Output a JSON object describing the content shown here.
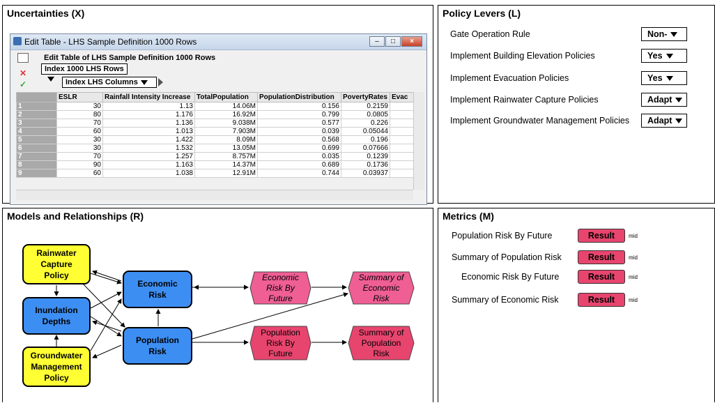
{
  "panels": {
    "uncertainties_title": "Uncertainties (X)",
    "levers_title": "Policy Levers (L)",
    "models_title": "Models and Relationships (R)",
    "metrics_title": "Metrics (M)"
  },
  "edit_window": {
    "title": "Edit Table - LHS Sample Definition 1000 Rows",
    "heading": "Edit Table of LHS Sample Definition 1000 Rows",
    "row_index": "Index 1000 LHS Rows",
    "col_index": "Index LHS Columns",
    "columns": [
      "ESLR",
      "Rainfall Intensity Increase",
      "TotalPopulation",
      "PopulationDistribution",
      "PovertyRates",
      "Evac"
    ],
    "rows": [
      {
        "n": "1",
        "cells": [
          "30",
          "1.13",
          "14.06M",
          "0.156",
          "0.2159",
          ""
        ]
      },
      {
        "n": "2",
        "cells": [
          "80",
          "1.176",
          "16.92M",
          "0.799",
          "0.0805",
          ""
        ]
      },
      {
        "n": "3",
        "cells": [
          "70",
          "1.136",
          "9.038M",
          "0.577",
          "0.226",
          ""
        ]
      },
      {
        "n": "4",
        "cells": [
          "60",
          "1.013",
          "7.903M",
          "0.039",
          "0.05044",
          ""
        ]
      },
      {
        "n": "5",
        "cells": [
          "30",
          "1.422",
          "8.09M",
          "0.568",
          "0.196",
          ""
        ]
      },
      {
        "n": "6",
        "cells": [
          "30",
          "1.532",
          "13.05M",
          "0.699",
          "0.07666",
          ""
        ]
      },
      {
        "n": "7",
        "cells": [
          "70",
          "1.257",
          "8.757M",
          "0.035",
          "0.1239",
          ""
        ]
      },
      {
        "n": "8",
        "cells": [
          "90",
          "1.163",
          "14.37M",
          "0.689",
          "0.1736",
          ""
        ]
      },
      {
        "n": "9",
        "cells": [
          "60",
          "1.038",
          "12.91M",
          "0.744",
          "0.03937",
          ""
        ]
      }
    ]
  },
  "levers": [
    {
      "label": "Gate Operation Rule",
      "value": "Non-"
    },
    {
      "label": "Implement Building Elevation Policies",
      "value": "Yes"
    },
    {
      "label": "Implement Evacuation Policies",
      "value": "Yes"
    },
    {
      "label": "Implement Rainwater Capture Policies",
      "value": "Adapt"
    },
    {
      "label": "Implement Groundwater Management Policies",
      "value": "Adapt"
    }
  ],
  "metrics": [
    {
      "label": "Population Risk By Future",
      "button": "Result",
      "tag": "mid"
    },
    {
      "label": "Summary of Population Risk",
      "button": "Result",
      "tag": "mid"
    },
    {
      "label": "Economic Risk By Future",
      "button": "Result",
      "tag": "mid"
    },
    {
      "label": "Summary of Economic Risk",
      "button": "Result",
      "tag": "mid"
    }
  ],
  "diagram": {
    "rainwater": "Rainwater Capture Policy",
    "inundation": "Inundation Depths",
    "groundwater": "Groundwater Management Policy",
    "economic": "Economic Risk",
    "population": "Population Risk",
    "econ_by_future": "Economic Risk By Future",
    "summary_econ": "Summary of Economic Risk",
    "pop_by_future": "Population Risk By Future",
    "summary_pop": "Summary of Population Risk"
  },
  "colors": {
    "yellow_node": "#ffff33",
    "blue_node": "#3d8ef2",
    "pink_italic": "#ef5f93",
    "red_objective": "#e8456e",
    "result_button": "#e8456e"
  }
}
